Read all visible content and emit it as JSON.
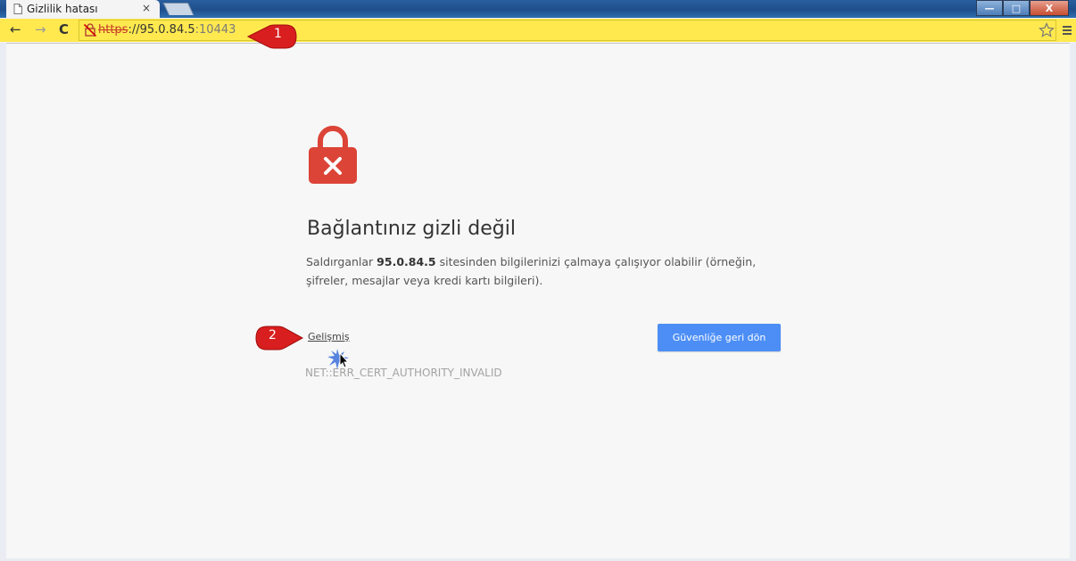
{
  "browser": {
    "tab_title": "Gizlilik hatası",
    "tab_close": "×",
    "window_controls": {
      "minimize": "—",
      "maximize": "□",
      "close": "X"
    },
    "nav": {
      "back": "←",
      "forward": "→",
      "reload": "C"
    },
    "omnibox": {
      "warning_icon": "not-secure-lock-icon",
      "scheme": "https",
      "separator": "://",
      "host": "95.0.84.5",
      "port": ":10443"
    },
    "bookmark_icon": "star-icon",
    "menu_icon": "hamburger-menu-icon",
    "omnibox_color": "#ffe94f"
  },
  "page": {
    "icon": "red-lock-error-icon",
    "title": "Bağlantınız gizli değil",
    "description_prefix": "Saldırganlar",
    "description_host": "95.0.84.5",
    "description_suffix": "sitesinden bilgilerinizi çalmaya çalışıyor olabilir (örneğin, şifreler, mesajlar veya kredi kartı bilgileri).",
    "advanced_link": "Gelişmiş",
    "error_code": "NET::ERR_CERT_AUTHORITY_INVALID",
    "back_button": "Güvenliğe geri dön",
    "button_color": "#4c8ef5",
    "lock_color": "#db4437"
  },
  "annotations": [
    {
      "label": "1"
    },
    {
      "label": "2"
    }
  ]
}
